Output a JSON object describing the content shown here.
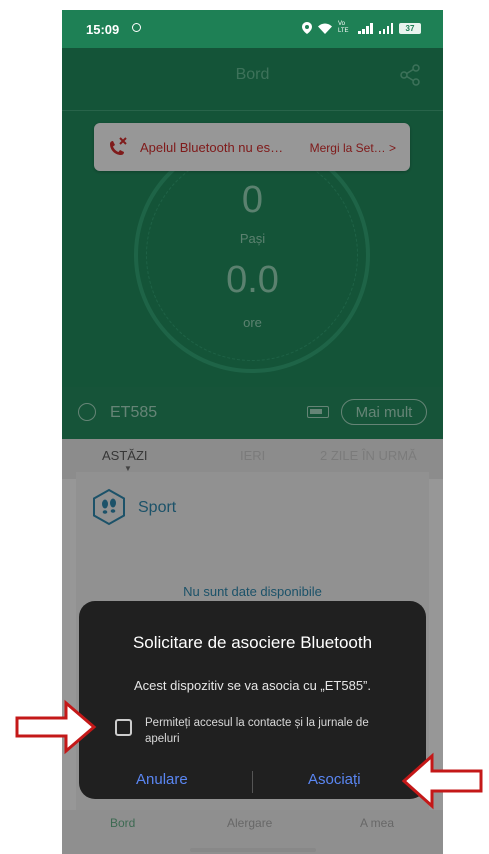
{
  "status_bar": {
    "time": "15:09",
    "network_label": "Vo LTE",
    "battery": "37"
  },
  "header": {
    "title": "Bord"
  },
  "metrics": {
    "steps_value": "0",
    "steps_label": "Pași",
    "hours_value": "0.0",
    "hours_label": "ore"
  },
  "toast": {
    "message": "Apelul Bluetooth nu es…",
    "link": "Mergi la Set… >"
  },
  "device": {
    "name": "ET585",
    "more_label": "Mai mult"
  },
  "tabs": [
    {
      "label": "ASTĂZI",
      "active": true
    },
    {
      "label": "IERI",
      "active": false
    },
    {
      "label": "2 ZILE ÎN URMĂ",
      "active": false
    }
  ],
  "card": {
    "title": "Sport",
    "empty_message": "Nu sunt date disponibile"
  },
  "bottom_nav": [
    {
      "label": "Bord",
      "active": true
    },
    {
      "label": "Alergare",
      "active": false
    },
    {
      "label": "A mea",
      "active": false
    }
  ],
  "dialog": {
    "title": "Solicitare de asociere Bluetooth",
    "message": "Acest dispozitiv se va asocia cu „ET585”.",
    "checkbox_label": "Permiteți accesul la contacte și la jurnale de apeluri",
    "checkbox_checked": false,
    "cancel_label": "Anulare",
    "confirm_label": "Asociați"
  },
  "colors": {
    "primary": "#208257",
    "accent": "#5a86f2",
    "alert": "#c42a2a",
    "annotation": "#c41818"
  }
}
